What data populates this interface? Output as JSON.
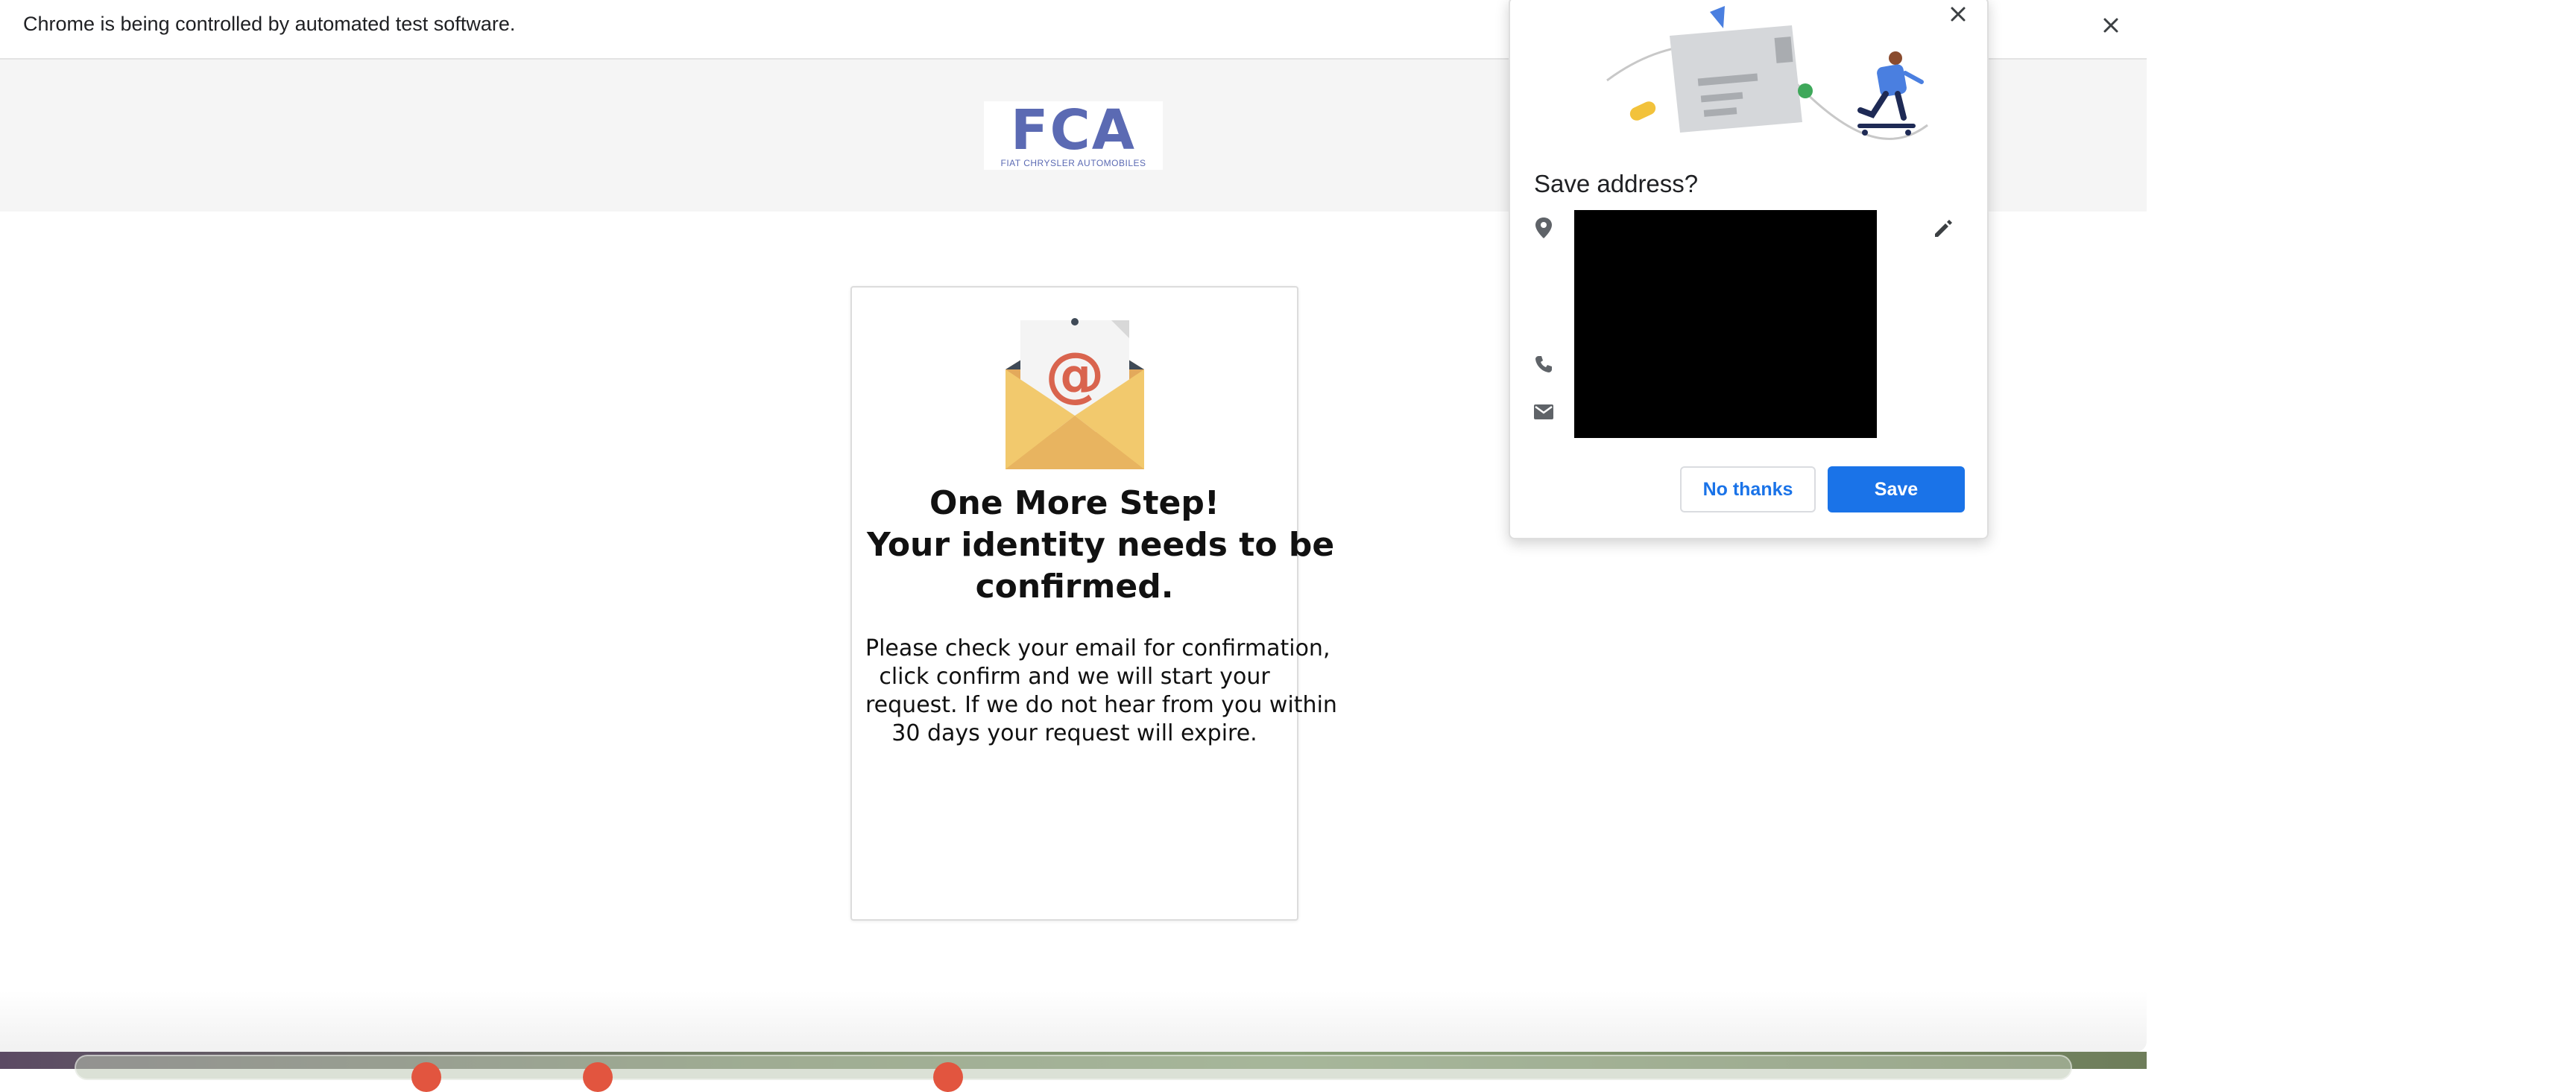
{
  "infobar": {
    "message": "Chrome is being controlled by automated test software.",
    "close_icon": "close-icon"
  },
  "header": {
    "logo_text": "FCA",
    "logo_subtext": "FIAT CHRYSLER AUTOMOBILES",
    "background": "#f5f5f5",
    "logo_color": "#5b6ab3"
  },
  "card": {
    "icon": "email-envelope-icon",
    "heading_lines": [
      "One More Step!",
      "Your identity needs to be",
      "confirmed."
    ],
    "body_lines": [
      "Please check your email for confirmation,",
      "click confirm and we will start your",
      "request. If we do not hear from you within",
      "30 days your request will expire."
    ]
  },
  "save_address_popup": {
    "title": "Save address?",
    "no_thanks_label": "No thanks",
    "save_label": "Save",
    "accent": "#1a73e8",
    "icons": [
      "location-pin-icon",
      "phone-icon",
      "mail-icon",
      "edit-icon",
      "close-icon"
    ]
  }
}
